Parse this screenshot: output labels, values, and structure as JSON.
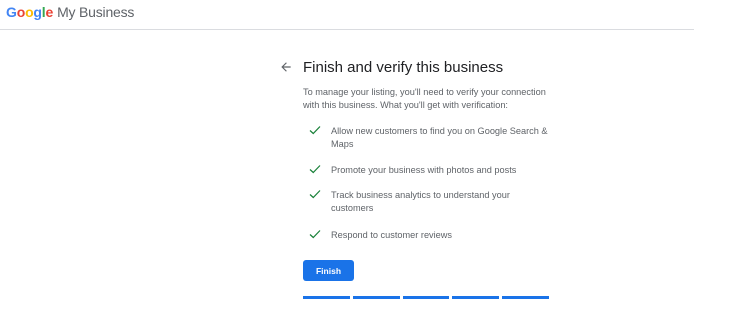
{
  "header": {
    "logo_letters": [
      "G",
      "o",
      "o",
      "g",
      "l",
      "e"
    ],
    "product_name": "My Business"
  },
  "main": {
    "title": "Finish and verify this business",
    "intro": "To manage your listing, you'll need to verify your connection with this business. What you'll get with verification:",
    "benefits": [
      "Allow new customers to find you on Google Search & Maps",
      "Promote your business with photos and posts",
      "Track business analytics to understand your customers",
      "Respond to customer reviews"
    ],
    "finish_label": "Finish",
    "progress_steps_completed": 5,
    "progress_steps_total": 5
  },
  "colors": {
    "accent": "#1a73e8",
    "check": "#188038",
    "text_primary": "#202124",
    "text_secondary": "#5f6368"
  },
  "icons": {
    "back": "arrow-back-icon",
    "check": "check-icon"
  }
}
